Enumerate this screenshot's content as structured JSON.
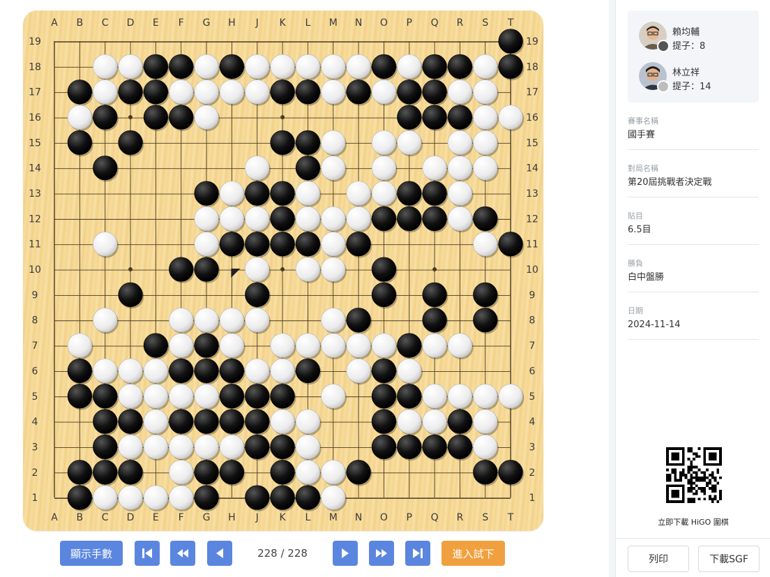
{
  "board": {
    "columns": [
      "A",
      "B",
      "C",
      "D",
      "E",
      "F",
      "G",
      "H",
      "J",
      "K",
      "L",
      "M",
      "N",
      "O",
      "P",
      "Q",
      "R",
      "S",
      "T"
    ],
    "rows_top_to_bottom": [
      "19",
      "18",
      "17",
      "16",
      "15",
      "14",
      "13",
      "12",
      "11",
      "10",
      "9",
      "8",
      "7",
      "6",
      "5",
      "4",
      "3",
      "2",
      "1"
    ],
    "grid": [
      "..................B",
      "..WWBBWBWWWWWBWBBWB",
      ".BWBBWWWWBBWBWBBWW.",
      ".WB.BBW.......BBBWW.W",
      ".B.B.....BBW.WW.WW.",
      "..B.....W.BW.W.WWW.",
      "......BWBBW.WWBBW..",
      "......WWWBWWWBBBWB.",
      "..W...WBBBBWB....WB",
      ".....BB.W.WW.B.....",
      "...B....B....B.B.B.",
      "..W..WWWW..WB..B.B.",
      ".W..BWBW.WWWWWBWW..",
      ".BWWWBBBWWB.WBW....",
      ".BBWWWWBBB.W.BBWWWW",
      "..BBWBBBBWW..BWWBW.W",
      "..BWWWWWBBW..BBBBW.",
      ".BBB.WBB.BWWB....BB",
      ".BWWWWB.BBBW......."
    ],
    "last_move": "H10",
    "last_move_color": "W",
    "star_points": [
      "D16",
      "K16",
      "Q16",
      "D10",
      "K10",
      "Q10",
      "D4",
      "K4",
      "Q4"
    ]
  },
  "controls": {
    "show_moves_label": "顯示手數",
    "first_icon": "skip-first-icon",
    "back_ten_icon": "fast-back-icon",
    "back_one_icon": "back-icon",
    "move_counter": "228 / 228",
    "next_one_icon": "next-icon",
    "forward_ten_icon": "fast-forward-icon",
    "last_icon": "skip-last-icon",
    "try_label": "進入試下"
  },
  "players": [
    {
      "name": "賴均輔",
      "captures": "提子：8",
      "color": "black"
    },
    {
      "name": "林立祥",
      "captures": "提子：14",
      "color": "white"
    }
  ],
  "info": [
    {
      "label": "賽事名稱",
      "value": "國手賽"
    },
    {
      "label": "對局名稱",
      "value": "第20屆挑戰者決定戰"
    },
    {
      "label": "貼目",
      "value": "6.5目"
    },
    {
      "label": "勝負",
      "value": "白中盤勝"
    },
    {
      "label": "日期",
      "value": "2024-11-14"
    }
  ],
  "qr_caption": "立即下載 HiGO 圍棋",
  "footer": {
    "print_label": "列印",
    "download_label": "下載SGF"
  },
  "colors": {
    "accent_blue": "#5b86df",
    "accent_orange": "#f0a03e",
    "board": "#f7dc9c"
  }
}
